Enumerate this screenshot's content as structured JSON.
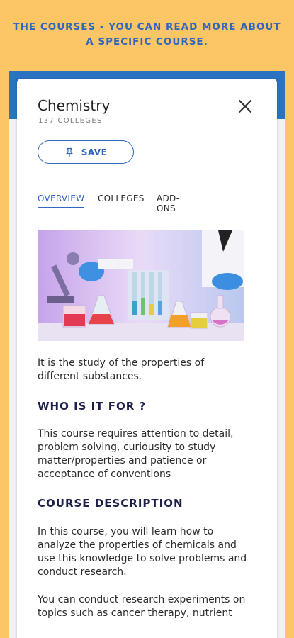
{
  "banner": {
    "line1": "THE COURSES - YOU CAN READ MORE ABOUT",
    "line2": "A SPECIFIC COURSE."
  },
  "course": {
    "title": "Chemistry",
    "subtitle": "137 COLLEGES",
    "save_label": "SAVE"
  },
  "tabs": [
    {
      "label": "OVERVIEW",
      "active": true
    },
    {
      "label": "COLLEGES",
      "active": false
    },
    {
      "label": "ADD-ONS",
      "active": false
    }
  ],
  "content": {
    "intro_line1": "It is the study of the properties of",
    "intro_line2": "different substances.",
    "who_title": "WHO IS IT FOR ?",
    "who_line1": "This course requires attention to detail,",
    "who_line2": "problem solving, curiousity to study",
    "who_line3": "matter/properties and patience or",
    "who_line4": "acceptance of conventions",
    "desc_title": "COURSE DESCRIPTION",
    "desc_line1": "In this course, you will learn how to",
    "desc_line2": "analyze the properties of chemicals and",
    "desc_line3": "use this knowledge to solve problems and",
    "desc_line4": "conduct research.",
    "desc2_line1": "You can conduct research experiments on",
    "desc2_line2": "topics such as cancer therapy, nutrient"
  },
  "colors": {
    "background": "#fcc666",
    "accent": "#2f66c0",
    "header_bar": "#2d72c2",
    "section_title": "#1c1f4a"
  },
  "icons": {
    "close": "close-icon",
    "pin": "pin-icon"
  }
}
